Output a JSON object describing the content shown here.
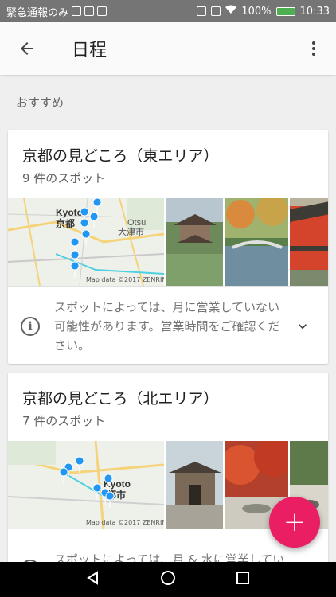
{
  "status_bar": {
    "left_text": "緊急通報のみ",
    "battery": "100%",
    "time": "10:33"
  },
  "appbar": {
    "title": "日程",
    "back_icon": "arrow-back-icon",
    "menu_icon": "more-vert-icon"
  },
  "section_label": "おすすめ",
  "cards": [
    {
      "title": "京都の見どころ（東エリア）",
      "subtitle": "9 件のスポット",
      "map_labels": [
        "Kyoto",
        "京都",
        "Otsu",
        "大津市"
      ],
      "map_credit": "Map data ©2017 ZENRIN",
      "info": "スポットによっては、月に営業していない可能性があります。営業時間をご確認ください。"
    },
    {
      "title": "京都の見どころ（北エリア）",
      "subtitle": "7 件のスポット",
      "map_labels": [
        "Kyoto",
        "都市"
      ],
      "map_credit": "Map data ©2017 ZENRIN",
      "info": "スポットによっては、月 & 水に営業していない可能性があります。営業時間"
    }
  ],
  "fab_label": "+",
  "colors": {
    "accent": "#e91e63",
    "pin": "#2196f3"
  }
}
